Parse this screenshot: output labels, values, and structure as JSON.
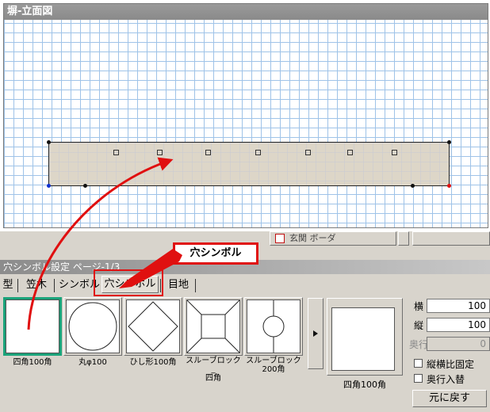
{
  "top_window": {
    "title": "塀-立面図"
  },
  "panel": {
    "title": "穴シンボル設定  ページ-1/3",
    "partial_row": {
      "text": "玄関  ボーダ"
    },
    "tabs": [
      {
        "label": "型"
      },
      {
        "label": "笠木"
      },
      {
        "label": "シンボル"
      },
      {
        "label": "穴シンボル"
      },
      {
        "label": "目地"
      }
    ],
    "symbols": [
      {
        "label": "四角100角",
        "icon": "square-icon"
      },
      {
        "label": "丸φ100",
        "icon": "circle-icon"
      },
      {
        "label": "ひし形100角",
        "icon": "diamond-icon"
      },
      {
        "label": "スルーブロック_四角",
        "label_line1": "スルーブロック_",
        "label_line2": "四角",
        "icon": "square-in-square-icon"
      },
      {
        "label": "スルーブロック200角",
        "label_line1": "スルーブロック",
        "label_line2": "200角",
        "icon": "circle-in-square-icon"
      }
    ],
    "preview": {
      "label": "四角100角"
    },
    "fields": {
      "width_label": "横",
      "width_value": "100",
      "height_label": "縦",
      "height_value": "100",
      "depth_label": "奥行",
      "depth_value": "0"
    },
    "checkboxes": {
      "aspect_lock": "縦横比固定",
      "swap_depth": "奥行入替"
    },
    "reset_button": "元に戻す"
  },
  "callout": {
    "text": "穴シンボル"
  },
  "colors": {
    "highlight": "#e01010",
    "selected_frame": "#1aa37a",
    "grid": "#9fc3e8"
  }
}
